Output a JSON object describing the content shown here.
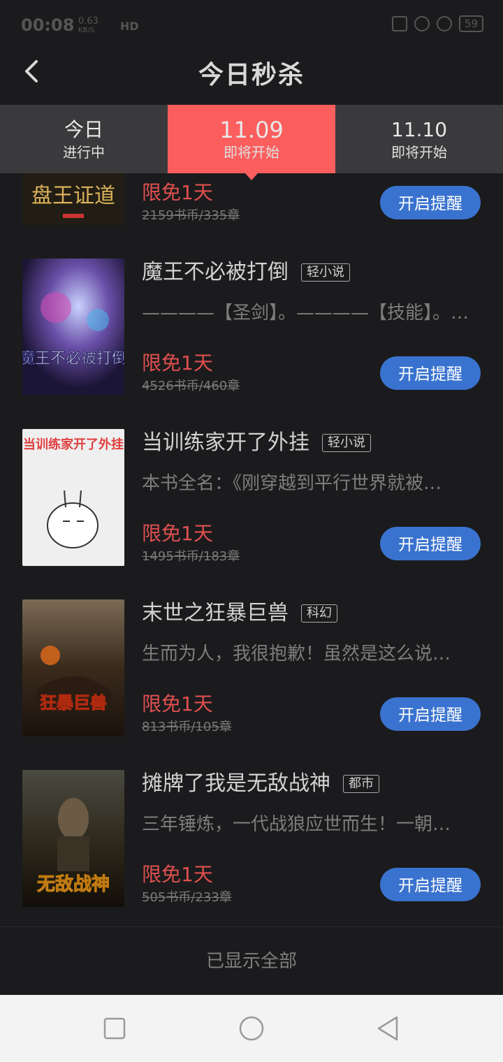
{
  "status_bar": {
    "time": "00:08",
    "net_speed": "0.63",
    "net_unit": "KB/S",
    "net_type": "HD",
    "battery": "59"
  },
  "header": {
    "title": "今日秒杀"
  },
  "tabs": [
    {
      "top": "今日",
      "bottom": "进行中",
      "active": false
    },
    {
      "top": "11.09",
      "bottom": "即将开始",
      "active": true
    },
    {
      "top": "11.10",
      "bottom": "即将开始",
      "active": false
    }
  ],
  "books": [
    {
      "title": "",
      "tag": "",
      "desc": "",
      "cover_text": "盘王证道",
      "free": "限免1天",
      "price": "2159书币/335章",
      "button": "开启提醒"
    },
    {
      "title": "魔王不必被打倒",
      "tag": "轻小说",
      "desc": "————【圣剑】。————【技能】。…",
      "cover_text": "魔王不必被打倒",
      "free": "限免1天",
      "price": "4526书币/460章",
      "button": "开启提醒"
    },
    {
      "title": "当训练家开了外挂",
      "tag": "轻小说",
      "desc": "本书全名：《刚穿越到平行世界就被…",
      "cover_text": "当训练家开了外挂",
      "free": "限免1天",
      "price": "1495书币/183章",
      "button": "开启提醒"
    },
    {
      "title": "末世之狂暴巨兽",
      "tag": "科幻",
      "desc": "生而为人，我很抱歉！虽然是这么说…",
      "cover_text": "狂暴巨兽",
      "free": "限免1天",
      "price": "813书币/105章",
      "button": "开启提醒"
    },
    {
      "title": "摊牌了我是无敌战神",
      "tag": "都市",
      "desc": "三年锤炼，一代战狼应世而生！一朝…",
      "cover_text": "无敌战神",
      "free": "限免1天",
      "price": "505书币/233章",
      "button": "开启提醒"
    }
  ],
  "footer": {
    "text": "已显示全部"
  },
  "colors": {
    "accent_tab": "#fc5e5e",
    "remind_button": "#3a73cf",
    "free_text": "#e0504f",
    "background": "#1b1b1d"
  }
}
